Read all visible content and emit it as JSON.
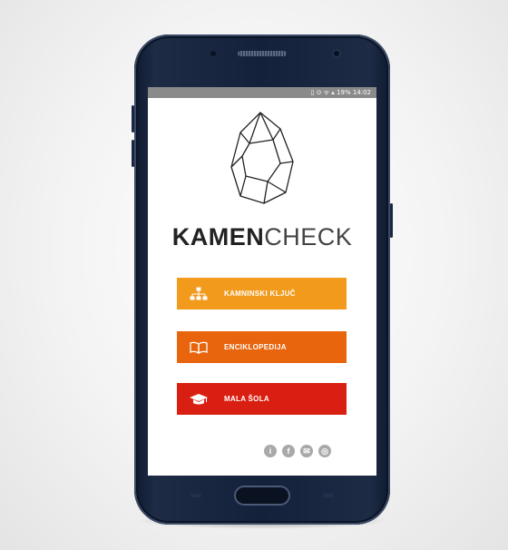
{
  "statusbar": {
    "text": "▯ ⊙ ᯤ ▴ 19% 14:02"
  },
  "app": {
    "name_bold": "KAMEN",
    "name_light": "CHECK"
  },
  "menu": [
    {
      "label": "KAMNINSKI KLJUČ",
      "icon": "hierarchy-icon",
      "color": "#f19a1c"
    },
    {
      "label": "ENCIKLOPEDIJA",
      "icon": "book-icon",
      "color": "#e8650d"
    },
    {
      "label": "MALA ŠOLA",
      "icon": "graduation-cap-icon",
      "color": "#d91f12"
    }
  ],
  "socials": [
    {
      "glyph": "i",
      "icon": "info-icon"
    },
    {
      "glyph": "f",
      "icon": "facebook-icon"
    },
    {
      "glyph": "✉",
      "icon": "mail-icon"
    },
    {
      "glyph": "◎",
      "icon": "instagram-icon"
    }
  ]
}
